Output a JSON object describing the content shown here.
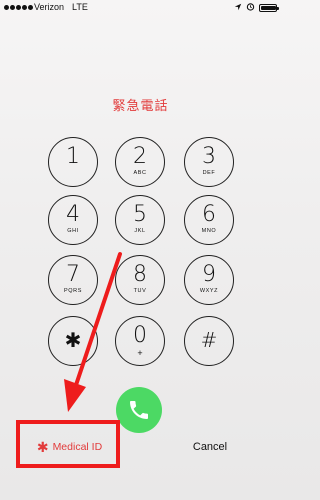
{
  "status_bar": {
    "carrier": "Verizon",
    "network": "LTE",
    "signal_bars_filled": 5
  },
  "title": "緊急電話",
  "keypad": [
    {
      "digit": "1",
      "letters": ""
    },
    {
      "digit": "2",
      "letters": "ABC"
    },
    {
      "digit": "3",
      "letters": "DEF"
    },
    {
      "digit": "4",
      "letters": "GHI"
    },
    {
      "digit": "5",
      "letters": "JKL"
    },
    {
      "digit": "6",
      "letters": "MNO"
    },
    {
      "digit": "7",
      "letters": "PQRS"
    },
    {
      "digit": "8",
      "letters": "TUV"
    },
    {
      "digit": "9",
      "letters": "WXYZ"
    },
    {
      "digit": "✱",
      "letters": ""
    },
    {
      "digit": "0",
      "letters": "+"
    },
    {
      "digit": "#",
      "letters": ""
    }
  ],
  "bottom": {
    "medical_id_symbol": "✱",
    "medical_id_label": "Medical ID",
    "cancel_label": "Cancel"
  },
  "colors": {
    "accent_red": "#e23b3b",
    "call_green": "#4cd964",
    "annotation_red": "#ee1c1c"
  },
  "icons": {
    "call": "phone-icon",
    "location": "location-arrow-icon",
    "alarm": "alarm-clock-icon",
    "battery": "battery-icon"
  }
}
